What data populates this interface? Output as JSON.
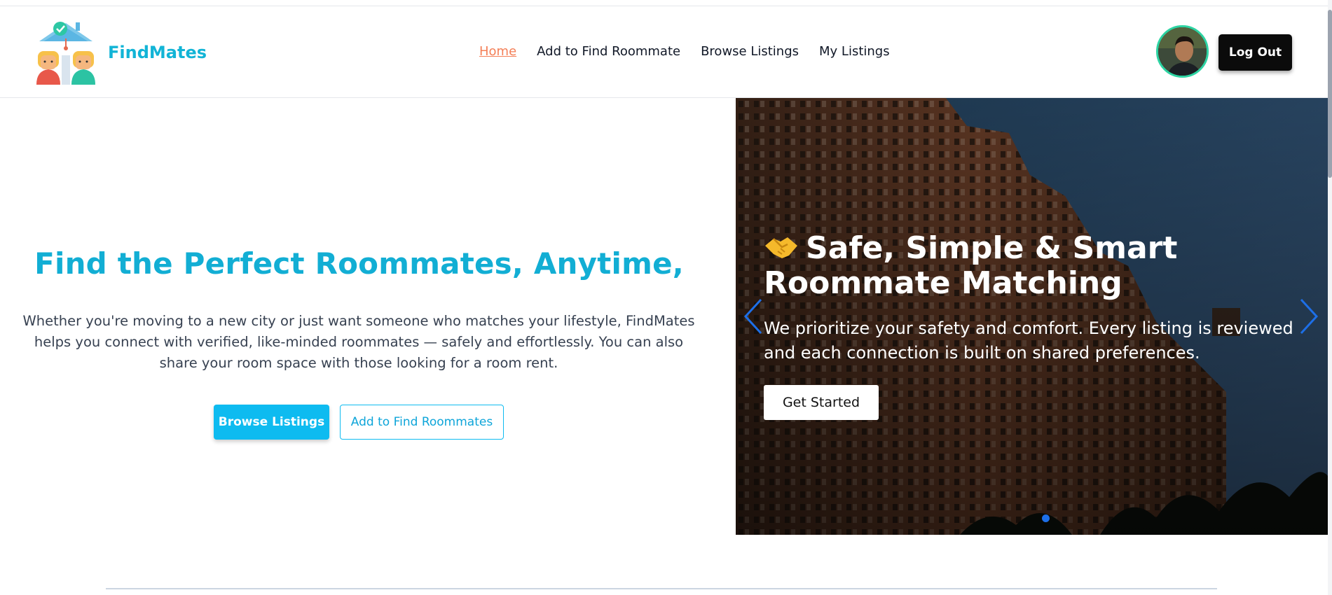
{
  "brand": {
    "name": "FindMates"
  },
  "nav": {
    "items": [
      {
        "label": "Home",
        "active": true
      },
      {
        "label": "Add to Find Roommate",
        "active": false
      },
      {
        "label": "Browse Listings",
        "active": false
      },
      {
        "label": "My Listings",
        "active": false
      }
    ],
    "logout_label": "Log Out"
  },
  "hero": {
    "title": "Find the Perfect Roommates, Anytime,",
    "description": "Whether you're moving to a new city or just want someone who matches your lifestyle, FindMates helps you connect with verified, like-minded roommates — safely and effortlessly. You can also share your room space with those looking for a room rent.",
    "primary_button": "Browse Listings",
    "secondary_button": "Add to Find Roommates"
  },
  "carousel": {
    "slide": {
      "emoji_icon": "handshake-icon",
      "title": "Safe, Simple & Smart Roommate Matching",
      "text": "We prioritize your safety and comfort. Every listing is reviewed and each connection is built on shared preferences.",
      "button": "Get Started"
    },
    "active_slide_index": 0,
    "arrow_color": "#1d6fe8"
  },
  "colors": {
    "brand": "#12b4d6",
    "active_nav": "#f47f57",
    "primary_button": "#0ebbf0",
    "logout_button": "#0b0b0b",
    "avatar_ring": "#2dd4a3"
  }
}
